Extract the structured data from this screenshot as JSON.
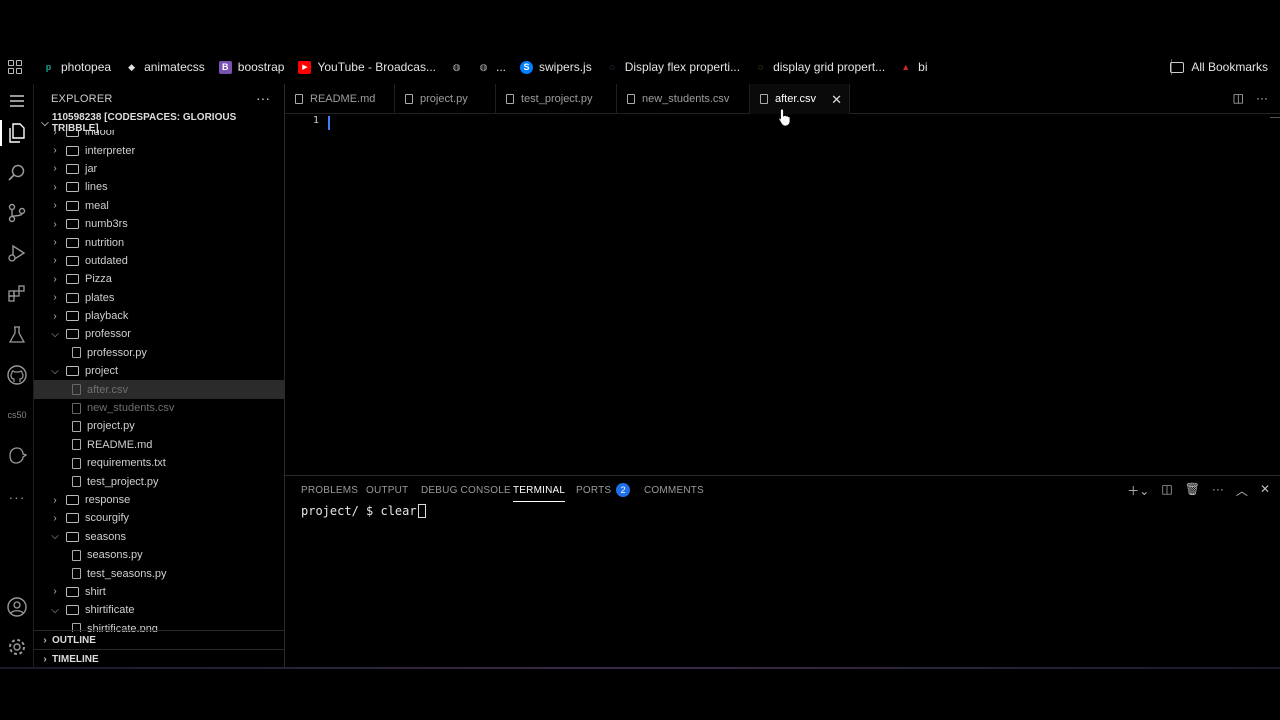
{
  "bookmarks": {
    "items": [
      {
        "label": "photopea",
        "icon": "photopea-icon",
        "color": "#18a497"
      },
      {
        "label": "animatecss",
        "icon": "animatecss-icon",
        "color": "#e3e3e3"
      },
      {
        "label": "boostrap",
        "icon": "bootstrap-icon",
        "color": "#7952b3"
      },
      {
        "label": "YouTube - Broadcas...",
        "icon": "youtube-icon",
        "color": "#ff0000"
      },
      {
        "label": "",
        "icon": "globe-icon",
        "color": "#aaaaaa"
      },
      {
        "label": "...",
        "icon": "globe-icon",
        "color": "#aaaaaa"
      },
      {
        "label": "swipers.js",
        "icon": "swiper-icon",
        "color": "#0080ff"
      },
      {
        "label": "Display flex properti...",
        "icon": "loading-icon",
        "color": "#8a7bd8"
      },
      {
        "label": "display grid propert...",
        "icon": "loading-icon",
        "color": "#e0b84a"
      },
      {
        "label": "bi",
        "icon": "bi-icon",
        "color": "#c62828"
      }
    ],
    "all_bookmarks": "All Bookmarks"
  },
  "sidebar": {
    "title": "EXPLORER",
    "workspace": "110598238 [CODESPACES: GLORIOUS TRIBBLE]",
    "tree": [
      {
        "label": "indoor",
        "type": "folder",
        "open": false,
        "depth": 0
      },
      {
        "label": "interpreter",
        "type": "folder",
        "open": false,
        "depth": 0
      },
      {
        "label": "jar",
        "type": "folder",
        "open": false,
        "depth": 0
      },
      {
        "label": "lines",
        "type": "folder",
        "open": false,
        "depth": 0
      },
      {
        "label": "meal",
        "type": "folder",
        "open": false,
        "depth": 0
      },
      {
        "label": "numb3rs",
        "type": "folder",
        "open": false,
        "depth": 0
      },
      {
        "label": "nutrition",
        "type": "folder",
        "open": false,
        "depth": 0
      },
      {
        "label": "outdated",
        "type": "folder",
        "open": false,
        "depth": 0
      },
      {
        "label": "Pizza",
        "type": "folder",
        "open": false,
        "depth": 0
      },
      {
        "label": "plates",
        "type": "folder",
        "open": false,
        "depth": 0
      },
      {
        "label": "playback",
        "type": "folder",
        "open": false,
        "depth": 0
      },
      {
        "label": "professor",
        "type": "folder",
        "open": true,
        "depth": 0
      },
      {
        "label": "professor.py",
        "type": "file",
        "depth": 1
      },
      {
        "label": "project",
        "type": "folder",
        "open": true,
        "depth": 0
      },
      {
        "label": "after.csv",
        "type": "file",
        "depth": 1,
        "selected": true,
        "dim": true
      },
      {
        "label": "new_students.csv",
        "type": "file",
        "depth": 1,
        "dim": true
      },
      {
        "label": "project.py",
        "type": "file",
        "depth": 1
      },
      {
        "label": "README.md",
        "type": "file",
        "depth": 1
      },
      {
        "label": "requirements.txt",
        "type": "file",
        "depth": 1
      },
      {
        "label": "test_project.py",
        "type": "file",
        "depth": 1
      },
      {
        "label": "response",
        "type": "folder",
        "open": false,
        "depth": 0
      },
      {
        "label": "scourgify",
        "type": "folder",
        "open": false,
        "depth": 0
      },
      {
        "label": "seasons",
        "type": "folder",
        "open": true,
        "depth": 0
      },
      {
        "label": "seasons.py",
        "type": "file",
        "depth": 1
      },
      {
        "label": "test_seasons.py",
        "type": "file",
        "depth": 1
      },
      {
        "label": "shirt",
        "type": "folder",
        "open": false,
        "depth": 0
      },
      {
        "label": "shirtificate",
        "type": "folder",
        "open": true,
        "depth": 0
      },
      {
        "label": "shirtificate.png",
        "type": "file",
        "depth": 1
      }
    ],
    "outline": "OUTLINE",
    "timeline": "TIMELINE"
  },
  "activity_bar": {
    "cs50_label": "cs50"
  },
  "tabs": [
    {
      "label": "README.md",
      "active": false
    },
    {
      "label": "project.py",
      "active": false
    },
    {
      "label": "test_project.py",
      "active": false
    },
    {
      "label": "new_students.csv",
      "active": false
    },
    {
      "label": "after.csv",
      "active": true
    }
  ],
  "editor": {
    "line_number": "1"
  },
  "panel": {
    "tabs": [
      {
        "label": "PROBLEMS"
      },
      {
        "label": "OUTPUT"
      },
      {
        "label": "DEBUG CONSOLE"
      },
      {
        "label": "TERMINAL",
        "active": true
      },
      {
        "label": "PORTS",
        "badge": "2"
      },
      {
        "label": "COMMENTS"
      }
    ],
    "terminal_prompt": "project/ $ clear"
  }
}
